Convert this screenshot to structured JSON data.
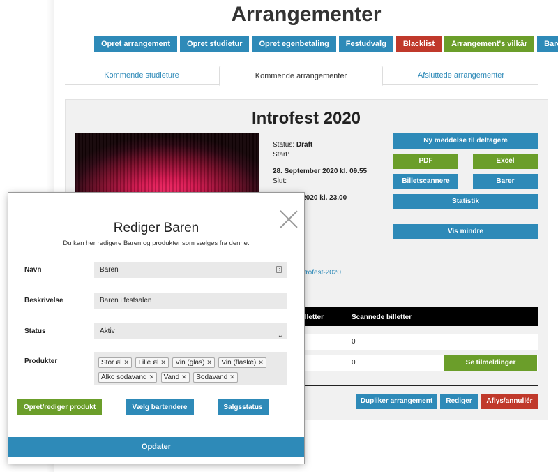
{
  "page_title": "Arrangementer",
  "top_buttons": [
    {
      "label": "Opret arrangement"
    },
    {
      "label": "Opret studietur"
    },
    {
      "label": "Opret egenbetaling"
    },
    {
      "label": "Festudvalg"
    },
    {
      "label": "Blacklist"
    },
    {
      "label": "Arrangement's vilkår"
    },
    {
      "label": "Barer"
    }
  ],
  "tabs": [
    {
      "label": "Kommende studieture"
    },
    {
      "label": "Kommende arrangementer"
    },
    {
      "label": "Afsluttede arrangementer"
    }
  ],
  "event": {
    "title": "Introfest 2020",
    "status_label": "Status:",
    "status_value": "Draft",
    "start_label": "Start:",
    "start_value": "28. September 2020 kl. 09.55",
    "end_label": "Slut:",
    "end_value_partial": "ptember 2020 kl. 23.00",
    "link_partial": "ntrofest-2020"
  },
  "actions": {
    "new_message": "Ny meddelse til deltagere",
    "pdf": "PDF",
    "excel": "Excel",
    "scanners": "Billetscannere",
    "bars": "Barer",
    "stats": "Statistik",
    "show_less": "Vis mindre"
  },
  "table": {
    "col1_partial": "illetter",
    "col2": "Scannede billetter",
    "rows": [
      {
        "scanned": "0"
      },
      {
        "scanned": "0",
        "button": "Se tilmeldinger"
      }
    ]
  },
  "bottom_buttons": {
    "duplicate": "Dupliker arrangement",
    "edit": "Rediger",
    "cancel": "Aflys/annullér"
  },
  "modal": {
    "title": "Rediger Baren",
    "subtitle": "Du kan her redigere Baren og produkter som sælges fra denne.",
    "name_label": "Navn",
    "name_value": "Baren",
    "description_label": "Beskrivelse",
    "description_value": "Baren i festsalen",
    "status_label": "Status",
    "status_value": "Aktiv",
    "products_label": "Produkter",
    "products": [
      "Stor øl",
      "Lille øl",
      "Vin (glas)",
      "Vin (flaske)",
      "Alko sodavand",
      "Vand",
      "Sodavand"
    ],
    "create_product": "Opret/rediger produkt",
    "choose_bartenders": "Vælg bartendere",
    "sales_status": "Salgsstatus",
    "update": "Opdater"
  },
  "colors": {
    "primary": "#2e8ab8",
    "danger": "#c0392b",
    "success": "#6b9e2a"
  }
}
